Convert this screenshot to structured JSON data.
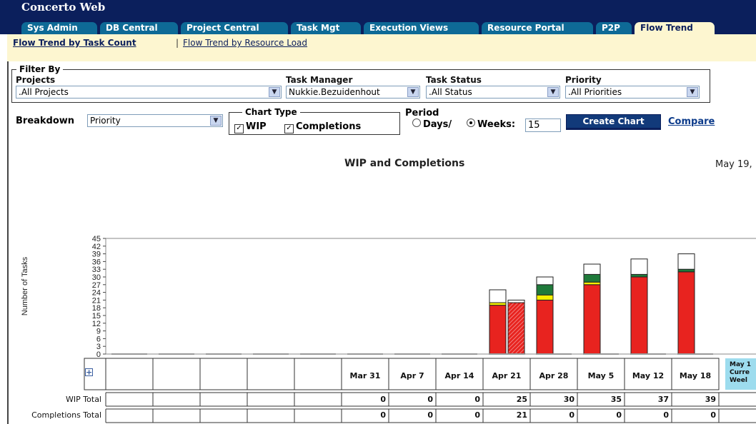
{
  "app": {
    "title": "Concerto Web"
  },
  "tabs": [
    {
      "label": "Sys Admin"
    },
    {
      "label": "DB Central"
    },
    {
      "label": "Project Central"
    },
    {
      "label": "Task Mgt"
    },
    {
      "label": "Execution Views"
    },
    {
      "label": "Resource Portal"
    },
    {
      "label": "P2P"
    },
    {
      "label": "Flow Trend"
    }
  ],
  "subnav": {
    "link_task_count": "Flow Trend by Task Count",
    "separator": "|",
    "link_resource_load": "Flow Trend by Resource Load"
  },
  "filter": {
    "legend": "Filter By",
    "projects_label": "Projects",
    "projects_value": ".All Projects",
    "task_manager_label": "Task Manager",
    "task_manager_value": "Nukkie.Bezuidenhout",
    "task_status_label": "Task Status",
    "task_status_value": ".All Status",
    "priority_label": "Priority",
    "priority_value": ".All Priorities"
  },
  "controls": {
    "breakdown_label": "Breakdown",
    "breakdown_value": "Priority",
    "chart_type_legend": "Chart Type",
    "wip_label": "WIP",
    "completions_label": "Completions",
    "period_label": "Period",
    "days_label": "Days/",
    "weeks_label": "Weeks:",
    "weeks_value": "15",
    "create_chart_label": "Create Chart",
    "compare_label": "Compare"
  },
  "chart_data": {
    "type": "bar",
    "title": "WIP and Completions",
    "date_label": "May 19,",
    "ylabel": "Number of Tasks",
    "ylim": [
      0,
      45
    ],
    "yticks": [
      0,
      3,
      6,
      9,
      12,
      15,
      18,
      21,
      24,
      27,
      30,
      33,
      36,
      39,
      42,
      45
    ],
    "categories": [
      "",
      "",
      "",
      "",
      "",
      "Mar 31",
      "Apr 7",
      "Apr 14",
      "Apr 21",
      "Apr 28",
      "May 5",
      "May 12",
      "May 18"
    ],
    "current_week_label": [
      "May 1",
      "Curre",
      "Weel"
    ],
    "wip_stacks": [
      {
        "category": "Apr 21",
        "segments": [
          {
            "color": "#e8231f",
            "value": 19
          },
          {
            "color": "#f6f000",
            "value": 1
          },
          {
            "color": "#ffffff",
            "value": 5
          }
        ]
      },
      {
        "category": "Apr 28",
        "segments": [
          {
            "color": "#e8231f",
            "value": 21
          },
          {
            "color": "#f6f000",
            "value": 2
          },
          {
            "color": "#1f7a3a",
            "value": 4
          },
          {
            "color": "#ffffff",
            "value": 3
          }
        ]
      },
      {
        "category": "May 5",
        "segments": [
          {
            "color": "#e8231f",
            "value": 27
          },
          {
            "color": "#f6f000",
            "value": 1
          },
          {
            "color": "#1f7a3a",
            "value": 3
          },
          {
            "color": "#ffffff",
            "value": 4
          }
        ]
      },
      {
        "category": "May 12",
        "segments": [
          {
            "color": "#e8231f",
            "value": 30
          },
          {
            "color": "#1f7a3a",
            "value": 1
          },
          {
            "color": "#ffffff",
            "value": 6
          }
        ]
      },
      {
        "category": "May 18",
        "segments": [
          {
            "color": "#e8231f",
            "value": 32
          },
          {
            "color": "#1f7a3a",
            "value": 1
          },
          {
            "color": "#ffffff",
            "value": 6
          }
        ]
      }
    ],
    "completion_stacks": [
      {
        "category": "Apr 21",
        "segments": [
          {
            "color": "#e8231f",
            "value": 20,
            "pattern": "hatched"
          },
          {
            "color": "#ffffff",
            "value": 1
          }
        ]
      }
    ],
    "rows": [
      {
        "label": "WIP Total",
        "values": [
          "",
          "",
          "",
          "",
          "",
          "0",
          "0",
          "0",
          "25",
          "30",
          "35",
          "37",
          "39"
        ]
      },
      {
        "label": "Completions Total",
        "values": [
          "",
          "",
          "",
          "",
          "",
          "0",
          "0",
          "0",
          "21",
          "0",
          "0",
          "0",
          "0"
        ]
      }
    ],
    "colors": {
      "red": "#e8231f",
      "yellow": "#f6f000",
      "green": "#1f7a3a",
      "current_week_bg": "#9ddcee"
    }
  }
}
